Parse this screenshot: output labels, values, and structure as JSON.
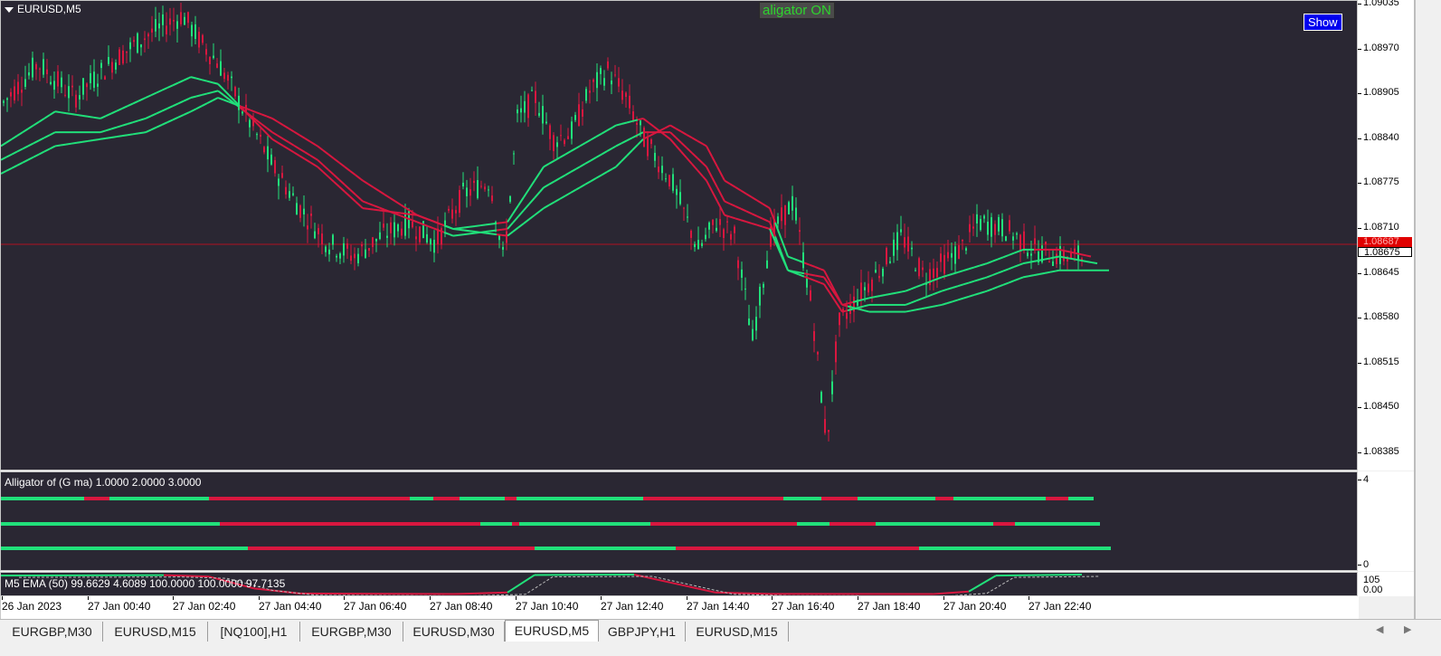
{
  "chart": {
    "symbol_title": "EURUSD,M5",
    "alligator_status": "aligator ON",
    "show_button": "Show",
    "current_price": "1.08675",
    "current_price_alt": "1.08687",
    "price_scale": [
      "1.09035",
      "1.08970",
      "1.08905",
      "1.08840",
      "1.08775",
      "1.08710",
      "1.08645",
      "1.08580",
      "1.08515",
      "1.08450",
      "1.08385"
    ],
    "time_axis": [
      "26 Jan 2023",
      "27 Jan 00:40",
      "27 Jan 02:40",
      "27 Jan 04:40",
      "27 Jan 06:40",
      "27 Jan 08:40",
      "27 Jan 10:40",
      "27 Jan 12:40",
      "27 Jan 14:40",
      "27 Jan 16:40",
      "27 Jan 18:40",
      "27 Jan 20:40",
      "27 Jan 22:40"
    ]
  },
  "indicators": {
    "alligator_label": "Alligator  of (G ma)  1.0000 2.0000 3.0000",
    "alligator_scale_top": "4",
    "alligator_scale_bottom": "0",
    "ema_label": "M5 EMA (50) 99.6629 4.6089 100.0000 100.0000 97.7135",
    "ema_scale_top": "105",
    "ema_scale_bottom": "0.00"
  },
  "tabs": [
    "EURGBP,M30",
    "EURUSD,M15",
    "[NQ100],H1",
    "EURGBP,M30",
    "EURUSD,M30",
    "EURUSD,M5",
    "GBPJPY,H1",
    "EURUSD,M15"
  ],
  "active_tab": "EURUSD,M5",
  "colors": {
    "background": "#2a2733",
    "bull": "#21e07a",
    "bear": "#d8173f",
    "price_line": "#b01020"
  },
  "chart_data": {
    "type": "candlestick",
    "symbol": "EURUSD",
    "timeframe": "M5",
    "ylim": [
      1.0837,
      1.0904
    ],
    "current_price": 1.08675,
    "x_range": [
      "26 Jan 2023 22:40",
      "27 Jan 23:55"
    ],
    "series": [
      {
        "name": "price",
        "points": [
          [
            0,
            1.0889
          ],
          [
            40,
            1.0895
          ],
          [
            80,
            1.089
          ],
          [
            120,
            1.0895
          ],
          [
            160,
            1.0899
          ],
          [
            200,
            1.0902
          ],
          [
            220,
            1.0898
          ],
          [
            240,
            1.0895
          ],
          [
            260,
            1.089
          ],
          [
            280,
            1.0885
          ],
          [
            300,
            1.088
          ],
          [
            330,
            1.0874
          ],
          [
            360,
            1.0869
          ],
          [
            390,
            1.0867
          ],
          [
            420,
            1.087
          ],
          [
            450,
            1.0872
          ],
          [
            480,
            1.0869
          ],
          [
            510,
            1.0876
          ],
          [
            540,
            1.0878
          ],
          [
            555,
            1.0866
          ],
          [
            570,
            1.0887
          ],
          [
            590,
            1.089
          ],
          [
            610,
            1.0884
          ],
          [
            630,
            1.0885
          ],
          [
            650,
            1.0891
          ],
          [
            670,
            1.0894
          ],
          [
            690,
            1.089
          ],
          [
            710,
            1.0884
          ],
          [
            740,
            1.0878
          ],
          [
            770,
            1.0868
          ],
          [
            790,
            1.0872
          ],
          [
            810,
            1.087
          ],
          [
            830,
            1.0855
          ],
          [
            850,
            1.087
          ],
          [
            875,
            1.0875
          ],
          [
            895,
            1.086
          ],
          [
            912,
            1.084
          ],
          [
            925,
            1.0857
          ],
          [
            945,
            1.0861
          ],
          [
            970,
            1.0865
          ],
          [
            995,
            1.087
          ],
          [
            1020,
            1.0864
          ],
          [
            1040,
            1.0866
          ],
          [
            1060,
            1.0868
          ],
          [
            1080,
            1.0872
          ],
          [
            1110,
            1.0871
          ],
          [
            1140,
            1.0868
          ],
          [
            1170,
            1.0867
          ],
          [
            1195,
            1.0867
          ]
        ]
      },
      {
        "name": "lips",
        "points": [
          [
            0,
            1.0883
          ],
          [
            60,
            1.0888
          ],
          [
            110,
            1.0887
          ],
          [
            160,
            1.089
          ],
          [
            210,
            1.0893
          ],
          [
            240,
            1.0892
          ],
          [
            300,
            1.0884
          ],
          [
            350,
            1.088
          ],
          [
            400,
            1.0874
          ],
          [
            460,
            1.0873
          ],
          [
            500,
            1.0871
          ],
          [
            560,
            1.0872
          ],
          [
            600,
            1.088
          ],
          [
            640,
            1.0883
          ],
          [
            680,
            1.0886
          ],
          [
            710,
            1.0887
          ],
          [
            740,
            1.0884
          ],
          [
            780,
            1.0878
          ],
          [
            800,
            1.0873
          ],
          [
            850,
            1.0871
          ],
          [
            870,
            1.0865
          ],
          [
            910,
            1.0864
          ],
          [
            930,
            1.086
          ],
          [
            960,
            1.0861
          ],
          [
            1000,
            1.0862
          ],
          [
            1040,
            1.0864
          ],
          [
            1090,
            1.0866
          ],
          [
            1130,
            1.0868
          ],
          [
            1170,
            1.0868
          ],
          [
            1205,
            1.0867
          ]
        ]
      },
      {
        "name": "teeth",
        "points": [
          [
            0,
            1.0881
          ],
          [
            60,
            1.0885
          ],
          [
            110,
            1.0885
          ],
          [
            160,
            1.0887
          ],
          [
            210,
            1.089
          ],
          [
            240,
            1.0891
          ],
          [
            300,
            1.0885
          ],
          [
            350,
            1.0881
          ],
          [
            400,
            1.0875
          ],
          [
            460,
            1.0872
          ],
          [
            500,
            1.087
          ],
          [
            560,
            1.0871
          ],
          [
            600,
            1.0877
          ],
          [
            640,
            1.088
          ],
          [
            680,
            1.0883
          ],
          [
            710,
            1.0885
          ],
          [
            740,
            1.0885
          ],
          [
            780,
            1.088
          ],
          [
            800,
            1.0875
          ],
          [
            850,
            1.0872
          ],
          [
            870,
            1.0865
          ],
          [
            910,
            1.0863
          ],
          [
            930,
            1.0859
          ],
          [
            960,
            1.086
          ],
          [
            1000,
            1.086
          ],
          [
            1040,
            1.0862
          ],
          [
            1090,
            1.0864
          ],
          [
            1130,
            1.0866
          ],
          [
            1170,
            1.0867
          ],
          [
            1212,
            1.0866
          ]
        ]
      },
      {
        "name": "jaw",
        "points": [
          [
            0,
            1.0879
          ],
          [
            60,
            1.0883
          ],
          [
            110,
            1.0884
          ],
          [
            160,
            1.0885
          ],
          [
            210,
            1.0888
          ],
          [
            240,
            1.089
          ],
          [
            300,
            1.0887
          ],
          [
            350,
            1.0883
          ],
          [
            400,
            1.0878
          ],
          [
            460,
            1.0873
          ],
          [
            500,
            1.0871
          ],
          [
            560,
            1.087
          ],
          [
            600,
            1.0874
          ],
          [
            640,
            1.0877
          ],
          [
            680,
            1.088
          ],
          [
            710,
            1.0884
          ],
          [
            740,
            1.0886
          ],
          [
            780,
            1.0883
          ],
          [
            800,
            1.0878
          ],
          [
            850,
            1.0874
          ],
          [
            870,
            1.0867
          ],
          [
            910,
            1.0865
          ],
          [
            930,
            1.086
          ],
          [
            960,
            1.0859
          ],
          [
            1000,
            1.0859
          ],
          [
            1040,
            1.086
          ],
          [
            1090,
            1.0862
          ],
          [
            1130,
            1.0864
          ],
          [
            1170,
            1.0865
          ],
          [
            1225,
            1.0865
          ]
        ]
      }
    ],
    "alligator_rows": [
      {
        "name": "row1",
        "segments": [
          [
            0,
            92,
            "bull"
          ],
          [
            92,
            120,
            "bear"
          ],
          [
            120,
            230,
            "bull"
          ],
          [
            230,
            452,
            "bear"
          ],
          [
            452,
            478,
            "bull"
          ],
          [
            478,
            507,
            "bear"
          ],
          [
            507,
            557,
            "bull"
          ],
          [
            557,
            570,
            "bear"
          ],
          [
            570,
            710,
            "bull"
          ],
          [
            710,
            865,
            "bear"
          ],
          [
            865,
            907,
            "bull"
          ],
          [
            907,
            947,
            "bear"
          ],
          [
            947,
            1033,
            "bull"
          ],
          [
            1033,
            1053,
            "bear"
          ],
          [
            1053,
            1155,
            "bull"
          ],
          [
            1155,
            1180,
            "bear"
          ],
          [
            1180,
            1208,
            "bull"
          ]
        ]
      },
      {
        "name": "row2",
        "segments": [
          [
            0,
            242,
            "bull"
          ],
          [
            242,
            530,
            "bear"
          ],
          [
            530,
            565,
            "bull"
          ],
          [
            565,
            573,
            "bear"
          ],
          [
            573,
            718,
            "bull"
          ],
          [
            718,
            880,
            "bear"
          ],
          [
            880,
            916,
            "bull"
          ],
          [
            916,
            967,
            "bear"
          ],
          [
            967,
            1097,
            "bull"
          ],
          [
            1097,
            1121,
            "bear"
          ],
          [
            1121,
            1215,
            "bull"
          ]
        ]
      },
      {
        "name": "row3",
        "segments": [
          [
            0,
            273,
            "bull"
          ],
          [
            273,
            590,
            "bear"
          ],
          [
            590,
            746,
            "bull"
          ],
          [
            746,
            1015,
            "bear"
          ],
          [
            1015,
            1227,
            "bull"
          ]
        ]
      }
    ],
    "ema_line": {
      "name": "EMA (50)",
      "points": [
        [
          0,
          95
        ],
        [
          180,
          97
        ],
        [
          230,
          90
        ],
        [
          280,
          30
        ],
        [
          330,
          5
        ],
        [
          500,
          2
        ],
        [
          560,
          10
        ],
        [
          590,
          98
        ],
        [
          700,
          100
        ],
        [
          740,
          60
        ],
        [
          790,
          10
        ],
        [
          850,
          3
        ],
        [
          1030,
          2
        ],
        [
          1070,
          15
        ],
        [
          1100,
          95
        ],
        [
          1195,
          100
        ]
      ]
    }
  }
}
